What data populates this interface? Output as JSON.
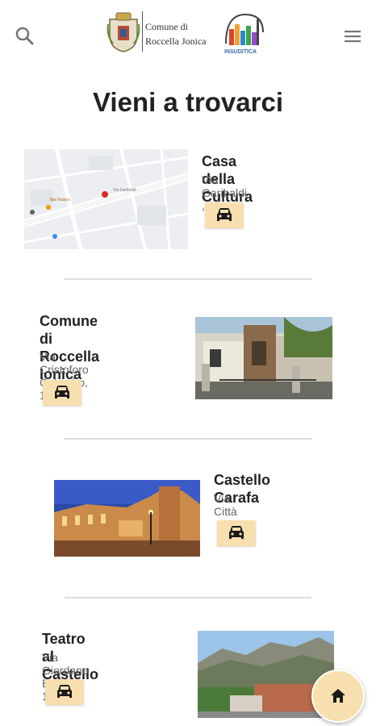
{
  "header": {
    "logo_line1": "Comune di",
    "logo_line2": "Roccella Jonica",
    "brand_text": "INSUDITICA"
  },
  "page": {
    "title": "Vieni a trovarci"
  },
  "places": [
    {
      "title": "Casa della Cultura",
      "address": "Via Garibaldi , 30",
      "map_labels": [
        "Via Garibaldi",
        "Bar Ruisco"
      ]
    },
    {
      "title": "Comune di Roccella Ionica",
      "title_line1": "Comune di Roccella",
      "title_line2": "Ionica",
      "address": "Via Cristoforo Colombo, 1"
    },
    {
      "title": "Castello Carafa",
      "address": "Via Città"
    },
    {
      "title": "Teatro al Castello",
      "address": "Via Giordano Bruno, 116"
    }
  ],
  "icons": {
    "search": "search-icon",
    "menu": "hamburger-menu-icon",
    "car": "car-icon",
    "home": "home-icon"
  },
  "colors": {
    "accent": "#f8dfaf",
    "title": "#222222",
    "subtitle": "#666666",
    "divider": "#dcdcdc"
  }
}
